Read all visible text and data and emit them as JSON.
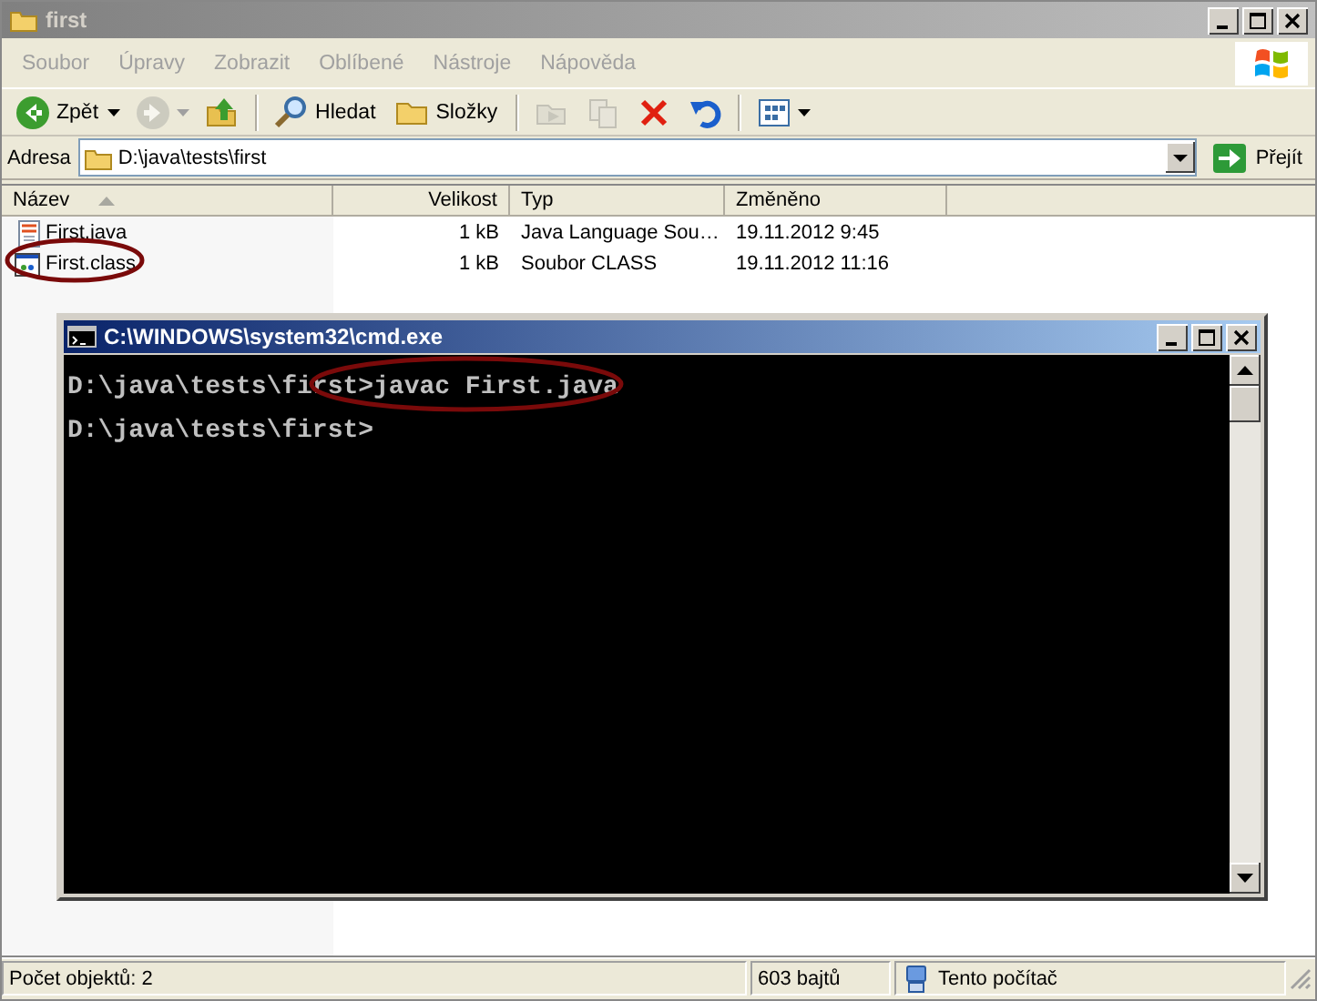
{
  "window": {
    "title": "first"
  },
  "menu": [
    {
      "label": "Soubor"
    },
    {
      "label": "Úpravy"
    },
    {
      "label": "Zobrazit"
    },
    {
      "label": "Oblíbené"
    },
    {
      "label": "Nástroje"
    },
    {
      "label": "Nápověda"
    }
  ],
  "toolbar": [
    {
      "kind": "back",
      "label": "Zpět",
      "disabled": false,
      "dropdown": true
    },
    {
      "kind": "forward",
      "disabled": true,
      "dropdown": true
    },
    {
      "kind": "up",
      "disabled": false
    },
    {
      "kind": "separator"
    },
    {
      "kind": "search",
      "label": "Hledat",
      "disabled": false
    },
    {
      "kind": "folders",
      "label": "Složky",
      "disabled": false
    },
    {
      "kind": "separator"
    },
    {
      "kind": "move",
      "disabled": true
    },
    {
      "kind": "copy",
      "disabled": true
    },
    {
      "kind": "delete",
      "disabled": false
    },
    {
      "kind": "undo",
      "disabled": false
    },
    {
      "kind": "separator"
    },
    {
      "kind": "views",
      "disabled": false,
      "dropdown": true
    }
  ],
  "address": {
    "label": "Adresa",
    "value": "D:\\java\\tests\\first",
    "go": "Přejít"
  },
  "table": {
    "columns": [
      {
        "label": "Název",
        "sorted": true
      },
      {
        "label": "Velikost",
        "sorted": false
      },
      {
        "label": "Typ",
        "sorted": false
      },
      {
        "label": "Změněno",
        "sorted": false
      }
    ],
    "rows": [
      {
        "kind": "java",
        "cells": [
          "First.java",
          "1 kB",
          "Java Language Sou…",
          "19.11.2012 9:45"
        ]
      },
      {
        "kind": "class",
        "cells": [
          "First.class",
          "1 kB",
          "Soubor CLASS",
          "19.11.2012 11:16"
        ]
      }
    ]
  },
  "console": {
    "title": "C:\\WINDOWS\\system32\\cmd.exe",
    "lines": [
      "D:\\java\\tests\\first>javac First.java",
      "D:\\java\\tests\\first>"
    ]
  },
  "status_bar": [
    "Počet objektů: 2",
    "603 bajtů",
    "Tento počítač"
  ]
}
